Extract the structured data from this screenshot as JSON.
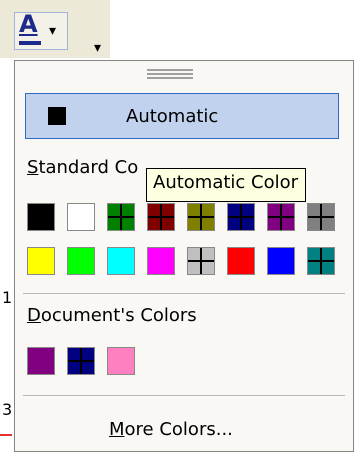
{
  "toolbar": {
    "font_color_letter": "A",
    "arrow_glyph": "▾"
  },
  "dropdown": {
    "automatic": {
      "label": "Automatic",
      "color": "#000000"
    },
    "standard_label_underlined": "S",
    "standard_label_rest": "tandard Co",
    "standard_colors": [
      "#000000",
      "#ffffff",
      "#008000",
      "#800000",
      "#808000",
      "#000080",
      "#800080",
      "#808080",
      "#ffff00",
      "#00ff00",
      "#00ffff",
      "#ff00ff",
      "#c0c0c0",
      "#ff0000",
      "#0000ff",
      "#008080"
    ],
    "document_label_underlined": "D",
    "document_label_rest": "ocument's Colors",
    "document_colors": [
      "#800080",
      "#000080",
      "#ff80c0"
    ],
    "more_colors_prefix": "",
    "more_colors_underlined": "M",
    "more_colors_rest": "ore Colors..."
  },
  "tooltip": {
    "text": "Automatic Color"
  },
  "background": {
    "digit": "1",
    "digit2": "3"
  }
}
